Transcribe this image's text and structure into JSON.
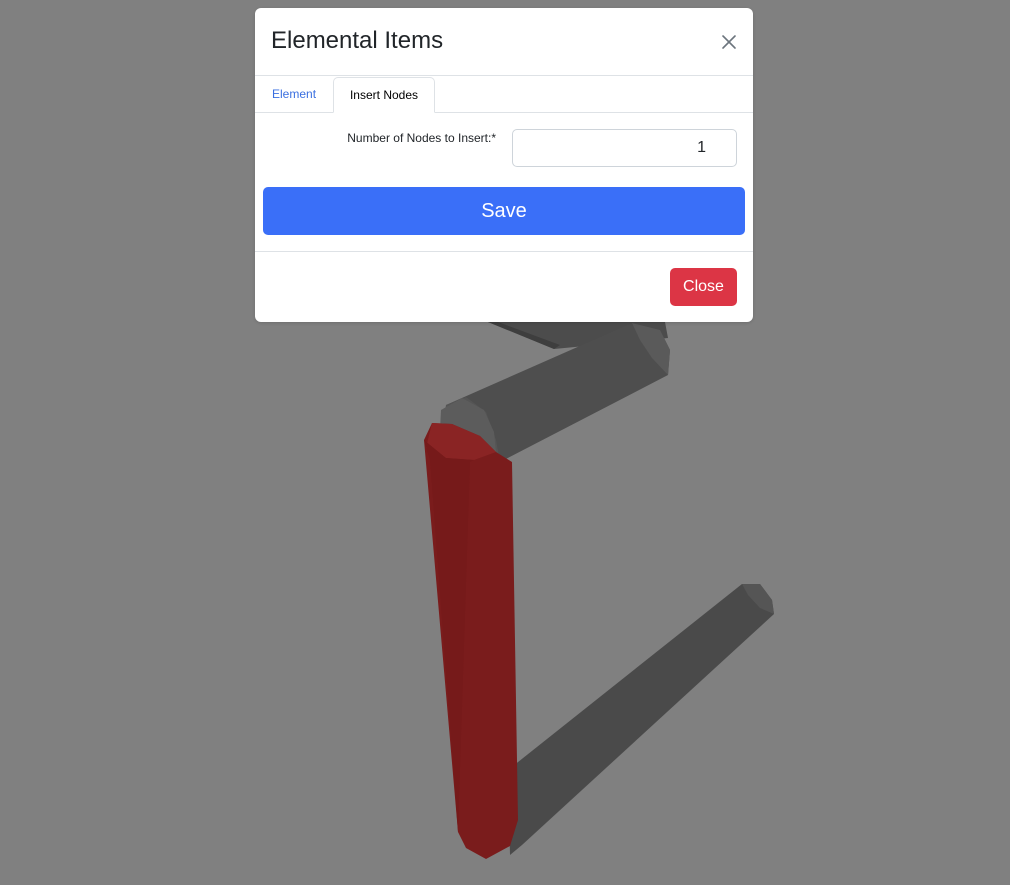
{
  "modal": {
    "title": "Elemental Items",
    "close_icon": "close-icon"
  },
  "tabs": [
    {
      "label": "Element",
      "active": false
    },
    {
      "label": "Insert Nodes",
      "active": true
    }
  ],
  "form": {
    "nodes_label": "Number of Nodes to Insert:*",
    "nodes_value": "1"
  },
  "buttons": {
    "save_label": "Save",
    "close_label": "Close"
  },
  "colors": {
    "background": "#808080",
    "primary": "#3a6ff8",
    "danger": "#dc3545",
    "link": "#3a6fe0",
    "selected_member": "#7a1c1c",
    "member": "#4a4a4a"
  }
}
